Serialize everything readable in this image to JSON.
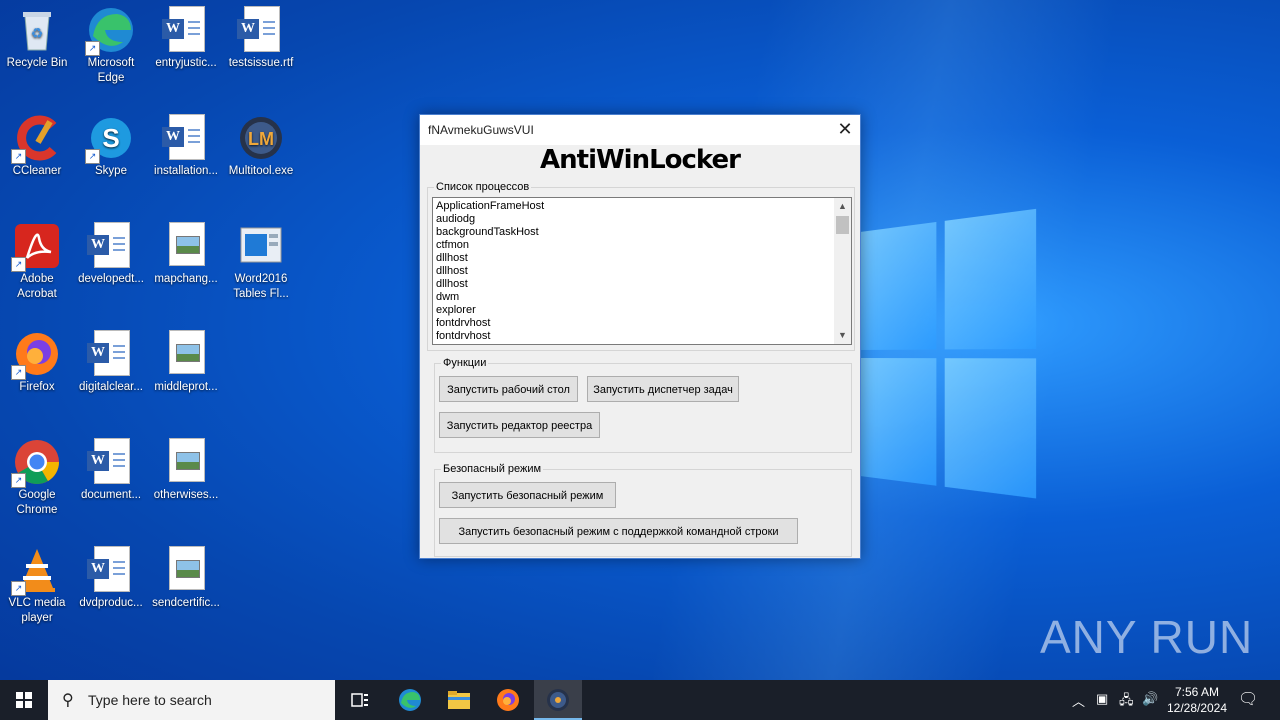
{
  "desktop": {
    "icons": [
      {
        "label": "Recycle Bin"
      },
      {
        "label": "Microsoft Edge"
      },
      {
        "label": "entryjustic..."
      },
      {
        "label": "testsissue.rtf"
      },
      {
        "label": "CCleaner"
      },
      {
        "label": "Skype"
      },
      {
        "label": "installation..."
      },
      {
        "label": "Multitool.exe"
      },
      {
        "label": "Adobe Acrobat"
      },
      {
        "label": "developedt..."
      },
      {
        "label": "mapchang..."
      },
      {
        "label": "Word2016 Tables Fl..."
      },
      {
        "label": "Firefox"
      },
      {
        "label": "digitalclear..."
      },
      {
        "label": "middleprot..."
      },
      {
        "label": "Google Chrome"
      },
      {
        "label": "document..."
      },
      {
        "label": "otherwises..."
      },
      {
        "label": "VLC media player"
      },
      {
        "label": "dvdproduc..."
      },
      {
        "label": "sendcertific..."
      }
    ],
    "watermark": "ANY RUN"
  },
  "dialog": {
    "window_title": "fNAvmekuGuwsVUI",
    "close_glyph": "✕",
    "app_title": "AntiWinLocker",
    "process_group_label": "Список процессов",
    "processes": [
      "ApplicationFrameHost",
      "audiodg",
      "backgroundTaskHost",
      "ctfmon",
      "dllhost",
      "dllhost",
      "dllhost",
      "dwm",
      "explorer",
      "fontdrvhost",
      "fontdrvhost"
    ],
    "functions_group_label": "Функции",
    "btn_desktop": "Запустить рабочий стол",
    "btn_taskmgr": "Запустить диспетчер задач",
    "btn_regedit": "Запустить редактор реестра",
    "safe_group_label": "Безопасный режим",
    "btn_safe": "Запустить безопасный режим",
    "btn_safe_cmd": "Запустить безопасный режим с поддержкой командной строки"
  },
  "taskbar": {
    "search_placeholder": "Type here to search",
    "time": "7:56 AM",
    "date": "12/28/2024"
  },
  "colors": {
    "accent": "#0a5fd6",
    "taskbar": "#1a1f29"
  }
}
